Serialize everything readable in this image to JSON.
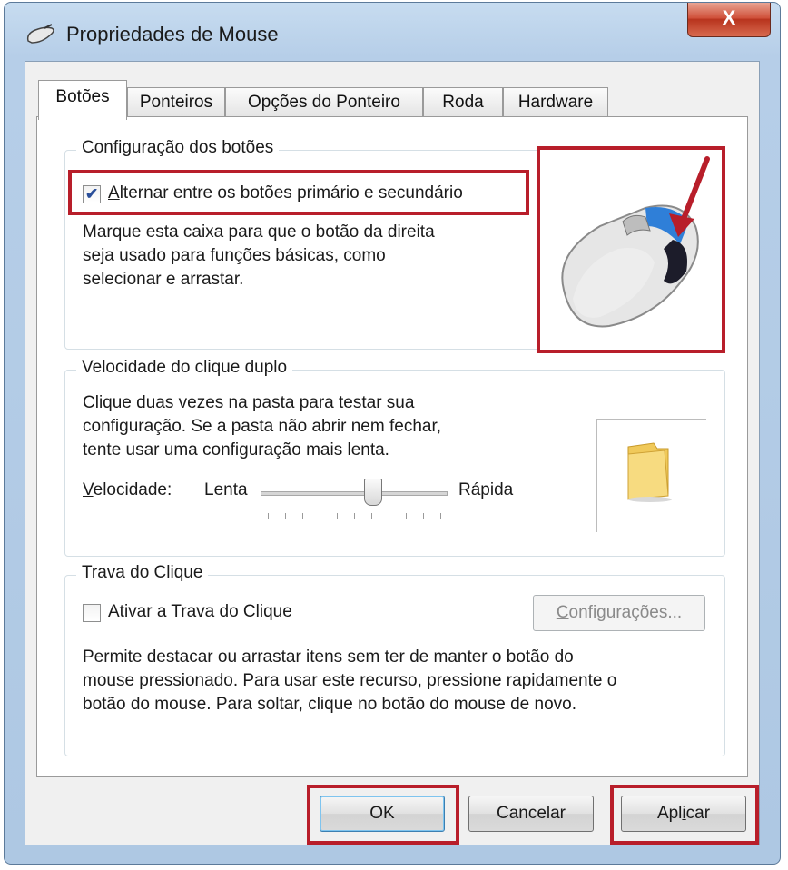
{
  "window": {
    "title": "Propriedades de Mouse",
    "close_label": "X"
  },
  "tabs": [
    {
      "label": "Botões",
      "active": true
    },
    {
      "label": "Ponteiros"
    },
    {
      "label": "Opções do Ponteiro"
    },
    {
      "label": "Roda"
    },
    {
      "label": "Hardware"
    }
  ],
  "button_config": {
    "title": "Configuração dos botões",
    "checkbox_label": "Alternar entre os botões primário e secundário",
    "checked": true,
    "description": [
      "Marque esta caixa para que o botão da direita",
      "seja usado para funções básicas, como",
      "selecionar e arrastar."
    ]
  },
  "double_click": {
    "title": "Velocidade do clique duplo",
    "description": [
      "Clique duas vezes na pasta para testar sua",
      "configuração. Se a pasta não abrir nem fechar,",
      "tente usar uma configuração mais lenta."
    ],
    "speed_label": "Velocidade:",
    "slow_label": "Lenta",
    "fast_label": "Rápida",
    "slider_value_fraction": 0.6,
    "tick_count": 11
  },
  "click_lock": {
    "title": "Trava do Clique",
    "checkbox_label": "Ativar a Trava do Clique",
    "checked": false,
    "settings_button": "Configurações...",
    "description": [
      "Permite destacar ou arrastar itens sem ter de manter o botão do",
      "mouse pressionado. Para usar este recurso, pressione rapidamente o",
      "botão do mouse. Para soltar, clique no botão do mouse de novo."
    ]
  },
  "footer": {
    "ok": "OK",
    "cancel": "Cancelar",
    "apply": "Aplicar"
  },
  "icons": {
    "title": "mouse-icon",
    "preview": "mouse-preview-icon",
    "folder": "folder-icon"
  },
  "colors": {
    "highlight": "#b81e2a",
    "close": "#c9472f",
    "mouse_accent": "#2f7fd8"
  }
}
